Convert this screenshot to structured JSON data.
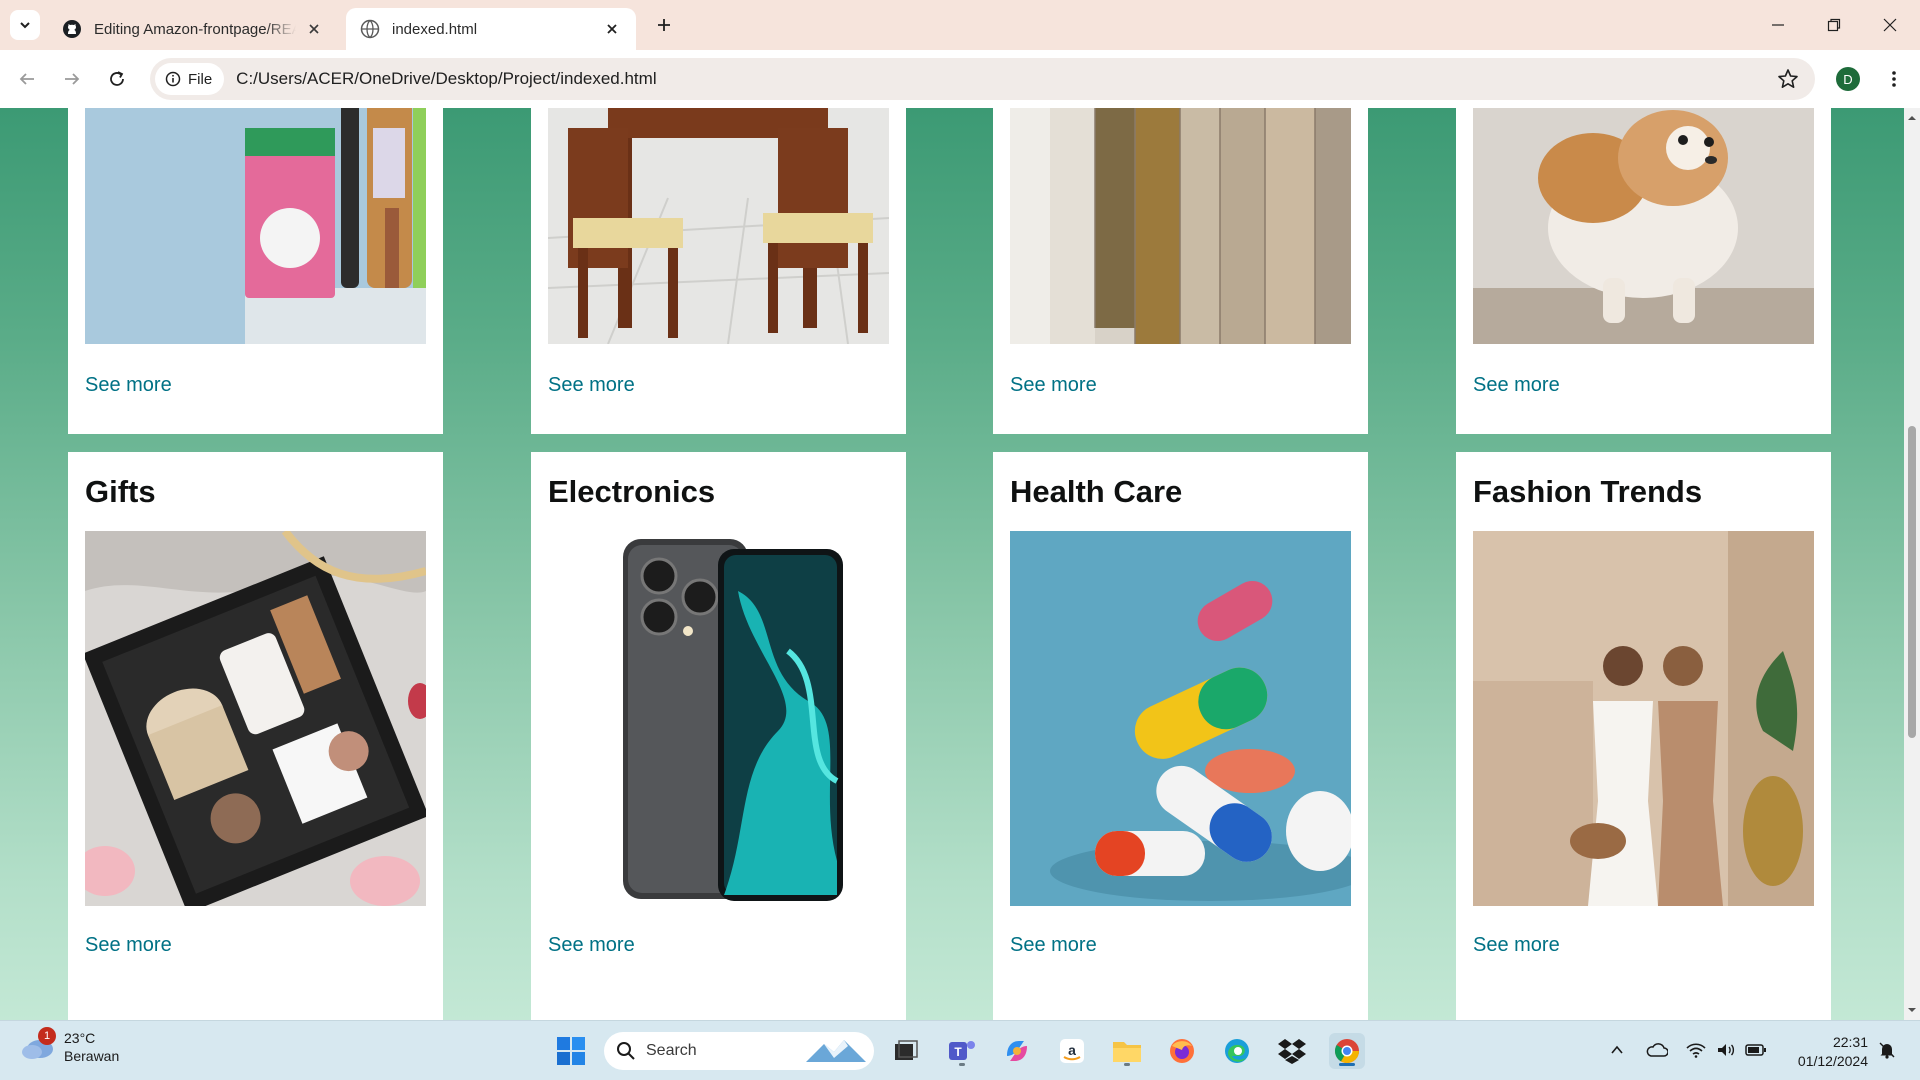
{
  "browser": {
    "tabs": [
      {
        "title": "Editing Amazon-frontpage/REA",
        "favicon": "github-icon",
        "active": false
      },
      {
        "title": "indexed.html",
        "favicon": "globe-icon",
        "active": true
      }
    ],
    "chip_label": "File",
    "url": "C:/Users/ACER/OneDrive/Desktop/Project/indexed.html",
    "profile_initial": "D"
  },
  "page": {
    "see_more_label": "See more",
    "top_row": [
      {
        "heading": "",
        "image": "beauty-products-photo"
      },
      {
        "heading": "",
        "image": "dining-table-photo"
      },
      {
        "heading": "",
        "image": "clothes-rack-photo"
      },
      {
        "heading": "",
        "image": "small-dog-photo"
      }
    ],
    "bottom_row": [
      {
        "heading": "Gifts",
        "image": "gift-box-photo"
      },
      {
        "heading": "Electronics",
        "image": "smartphone-photo"
      },
      {
        "heading": "Health Care",
        "image": "pills-photo"
      },
      {
        "heading": "Fashion Trends",
        "image": "fashion-models-photo"
      }
    ]
  },
  "taskbar": {
    "weather": {
      "badge": "1",
      "temperature": "23°C",
      "condition": "Berawan"
    },
    "search_placeholder": "Search",
    "time": "22:31",
    "date": "01/12/2024"
  },
  "colors": {
    "page_gradient_top": "#3c9a74",
    "page_gradient_bottom": "#c3e8d5",
    "link": "#007185",
    "tabstrip": "#f6e4dc"
  }
}
